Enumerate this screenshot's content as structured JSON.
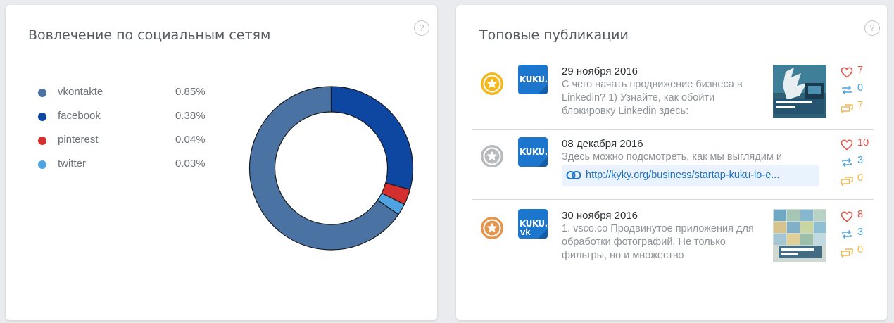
{
  "left_card": {
    "title": "Вовлечение по социальным сетям",
    "help": "?",
    "legend": [
      {
        "name": "vkontakte",
        "value": "0.85%",
        "color": "#4a72a3"
      },
      {
        "name": "facebook",
        "value": "0.38%",
        "color": "#0d47a1"
      },
      {
        "name": "pinterest",
        "value": "0.04%",
        "color": "#d32f2f"
      },
      {
        "name": "twitter",
        "value": "0.03%",
        "color": "#4fa3e3"
      }
    ]
  },
  "chart_data": {
    "type": "pie",
    "donut": true,
    "categories": [
      "vkontakte",
      "facebook",
      "pinterest",
      "twitter"
    ],
    "values": [
      0.85,
      0.38,
      0.04,
      0.03
    ],
    "colors": [
      "#4a72a3",
      "#0d47a1",
      "#d32f2f",
      "#4fa3e3"
    ],
    "start": "top",
    "direction": "clockwise",
    "order": [
      "facebook",
      "pinterest",
      "twitter",
      "vkontakte"
    ]
  },
  "right_card": {
    "title": "Топовые публикации",
    "help": "?",
    "posts": [
      {
        "rank": "gold",
        "medal_color": "#f2b81c",
        "logo": "KUKU.IO",
        "network": "",
        "date": "29 ноября 2016",
        "text": "С чего начать продвижение бизнеса в Linkedin? 1) Узнайте, как обойти блокировку Linkedin здесь:",
        "link": "",
        "likes": "7",
        "reposts": "0",
        "comments": "7"
      },
      {
        "rank": "silver",
        "medal_color": "#b8bbbe",
        "logo": "KUKU.IO",
        "network": "",
        "date": "08 декабря 2016",
        "text": "Здесь можно подсмотреть, как мы выглядим и",
        "link": "http://kyky.org/business/startap-kuku-io-e...",
        "likes": "10",
        "reposts": "3",
        "comments": "0"
      },
      {
        "rank": "bronze",
        "medal_color": "#e5964e",
        "logo": "KUKU.IO",
        "network": "vk",
        "date": "30 ноября 2016",
        "text": "1. vsco.co Продвинутое приложения для обработки фотографий. Не только фильтры, но и множество",
        "link": "",
        "likes": "8",
        "reposts": "3",
        "comments": "0"
      }
    ]
  }
}
